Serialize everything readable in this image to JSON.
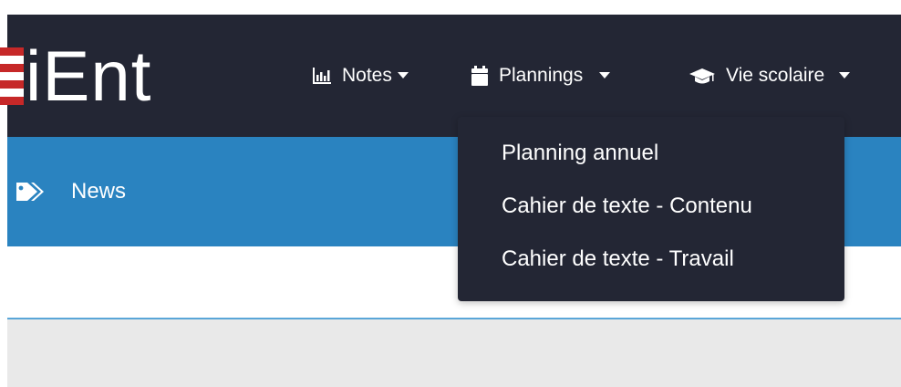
{
  "brand": {
    "logo_text": "iEnt",
    "colors": {
      "navbar_bg": "#232634",
      "news_bg": "#2a83c0",
      "logo_red": "#c62828"
    }
  },
  "nav": {
    "items": [
      {
        "label": "Notes",
        "icon": "bar-chart-icon"
      },
      {
        "label": "Plannings",
        "icon": "calendar-icon"
      },
      {
        "label": "Vie scolaire",
        "icon": "graduation-cap-icon"
      }
    ]
  },
  "dropdown": {
    "items": [
      {
        "label": "Planning annuel"
      },
      {
        "label": "Cahier de texte - Contenu"
      },
      {
        "label": "Cahier de texte - Travail"
      }
    ]
  },
  "news": {
    "label": "News",
    "icon": "tags-icon"
  }
}
